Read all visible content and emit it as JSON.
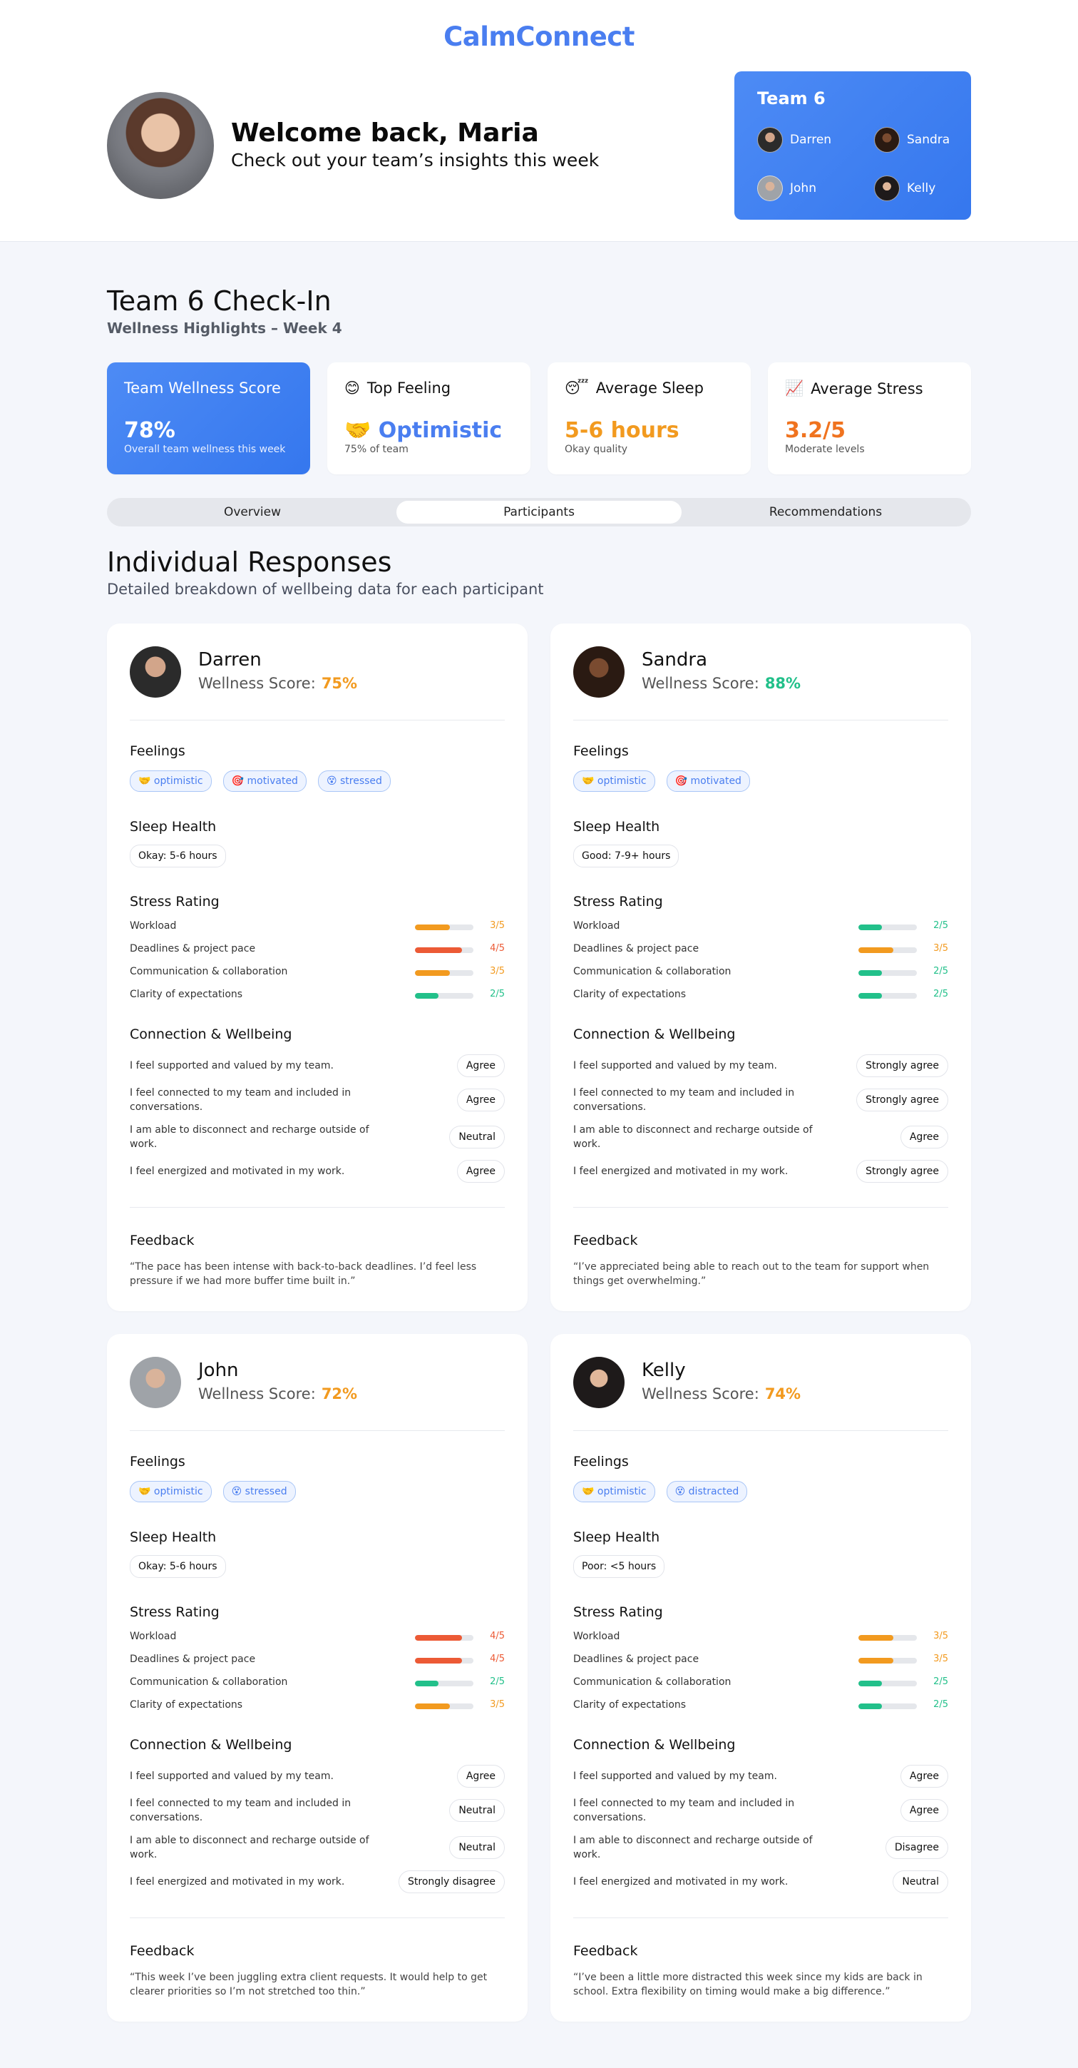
{
  "app": {
    "title": "CalmConnect"
  },
  "welcome": {
    "title": "Welcome back, Maria",
    "subtitle": "Check out your team’s insights this week"
  },
  "team": {
    "name": "Team 6",
    "members": [
      {
        "name": "Darren",
        "avatar": "darren-avatar"
      },
      {
        "name": "Sandra",
        "avatar": "sandra-avatar"
      },
      {
        "name": "John",
        "avatar": "john-avatar"
      },
      {
        "name": "Kelly",
        "avatar": "kelly-avatar"
      }
    ]
  },
  "checkin": {
    "title": "Team 6 Check-In",
    "subtitle": "Wellness Highlights – Week 4"
  },
  "stats": [
    {
      "label": "Team Wellness Score",
      "icon": "",
      "value": "78%",
      "note": "Overall team wellness this week",
      "color": "#ffffff"
    },
    {
      "label": "Top Feeling",
      "icon": "😊",
      "value": "🤝 Optimistic",
      "note": "75% of team",
      "color": "#4a7ef0"
    },
    {
      "label": "Average Sleep",
      "icon": "😴",
      "value": "5-6 hours",
      "note": "Okay quality",
      "color": "#f29a1f"
    },
    {
      "label": "Average Stress",
      "icon": "📈",
      "value": "3.2/5",
      "note": "Moderate levels",
      "color": "#f0731f"
    }
  ],
  "tabs": [
    {
      "label": "Overview",
      "active": false
    },
    {
      "label": "Participants",
      "active": true
    },
    {
      "label": "Recommendations",
      "active": false
    }
  ],
  "responses": {
    "title": "Individual Responses",
    "subtitle": "Detailed breakdown of wellbeing data for each participant"
  },
  "labels": {
    "wellness_score": "Wellness Score:",
    "feelings": "Feelings",
    "sleep_health": "Sleep Health",
    "stress_rating": "Stress Rating",
    "connection": "Connection & Wellbeing",
    "feedback": "Feedback"
  },
  "colors": {
    "green": "#22c08a",
    "orange": "#f29a1f",
    "red": "#ec5a35",
    "blue": "#4a7ef0"
  },
  "participants": [
    {
      "name": "Darren",
      "score": "75%",
      "score_color": "#f29a1f",
      "feelings": [
        "🤝 optimistic",
        "🎯 motivated",
        "😵 stressed"
      ],
      "sleep": "Okay: 5-6 hours",
      "stress": [
        {
          "label": "Workload",
          "value": "3/5",
          "level": 3
        },
        {
          "label": "Deadlines & project pace",
          "value": "4/5",
          "level": 4
        },
        {
          "label": "Communication & collaboration",
          "value": "3/5",
          "level": 3
        },
        {
          "label": "Clarity of expectations",
          "value": "2/5",
          "level": 2
        }
      ],
      "connection": [
        {
          "text": "I feel supported and valued by my team.",
          "answer": "Agree"
        },
        {
          "text": "I feel connected to my team and included in conversations.",
          "answer": "Agree"
        },
        {
          "text": "I am able to disconnect and recharge outside of work.",
          "answer": "Neutral"
        },
        {
          "text": "I feel energized and motivated in my work.",
          "answer": "Agree"
        }
      ],
      "feedback": "“The pace has been intense with back-to-back deadlines. I’d feel less pressure if we had more buffer time built in.”"
    },
    {
      "name": "Sandra",
      "score": "88%",
      "score_color": "#22c08a",
      "feelings": [
        "🤝 optimistic",
        "🎯 motivated"
      ],
      "sleep": "Good: 7-9+ hours",
      "stress": [
        {
          "label": "Workload",
          "value": "2/5",
          "level": 2
        },
        {
          "label": "Deadlines & project pace",
          "value": "3/5",
          "level": 3
        },
        {
          "label": "Communication & collaboration",
          "value": "2/5",
          "level": 2
        },
        {
          "label": "Clarity of expectations",
          "value": "2/5",
          "level": 2
        }
      ],
      "connection": [
        {
          "text": "I feel supported and valued by my team.",
          "answer": "Strongly agree"
        },
        {
          "text": "I feel connected to my team and included in conversations.",
          "answer": "Strongly agree"
        },
        {
          "text": "I am able to disconnect and recharge outside of work.",
          "answer": "Agree"
        },
        {
          "text": "I feel energized and motivated in my work.",
          "answer": "Strongly agree"
        }
      ],
      "feedback": "“I’ve appreciated being able to reach out to the team for support when things get overwhelming.”"
    },
    {
      "name": "John",
      "score": "72%",
      "score_color": "#f29a1f",
      "feelings": [
        "🤝 optimistic",
        "😵 stressed"
      ],
      "sleep": "Okay: 5-6 hours",
      "stress": [
        {
          "label": "Workload",
          "value": "4/5",
          "level": 4
        },
        {
          "label": "Deadlines & project pace",
          "value": "4/5",
          "level": 4
        },
        {
          "label": "Communication & collaboration",
          "value": "2/5",
          "level": 2
        },
        {
          "label": "Clarity of expectations",
          "value": "3/5",
          "level": 3
        }
      ],
      "connection": [
        {
          "text": "I feel supported and valued by my team.",
          "answer": "Agree"
        },
        {
          "text": "I feel connected to my team and included in conversations.",
          "answer": "Neutral"
        },
        {
          "text": "I am able to disconnect and recharge outside of work.",
          "answer": "Neutral"
        },
        {
          "text": "I feel energized and motivated in my work.",
          "answer": "Strongly disagree"
        }
      ],
      "feedback": "“This week I’ve been juggling extra client requests. It would help to get clearer priorities so I’m not stretched too thin.”"
    },
    {
      "name": "Kelly",
      "score": "74%",
      "score_color": "#f29a1f",
      "feelings": [
        "🤝 optimistic",
        "😵 distracted"
      ],
      "sleep": "Poor: <5 hours",
      "stress": [
        {
          "label": "Workload",
          "value": "3/5",
          "level": 3
        },
        {
          "label": "Deadlines & project pace",
          "value": "3/5",
          "level": 3
        },
        {
          "label": "Communication & collaboration",
          "value": "2/5",
          "level": 2
        },
        {
          "label": "Clarity of expectations",
          "value": "2/5",
          "level": 2
        }
      ],
      "connection": [
        {
          "text": "I feel supported and valued by my team.",
          "answer": "Agree"
        },
        {
          "text": "I feel connected to my team and included in conversations.",
          "answer": "Agree"
        },
        {
          "text": "I am able to disconnect and recharge outside of work.",
          "answer": "Disagree"
        },
        {
          "text": "I feel energized and motivated in my work.",
          "answer": "Neutral"
        }
      ],
      "feedback": "“I’ve been a little more distracted this week since my kids are back in school. Extra flexibility on timing would make a big difference.”"
    }
  ]
}
